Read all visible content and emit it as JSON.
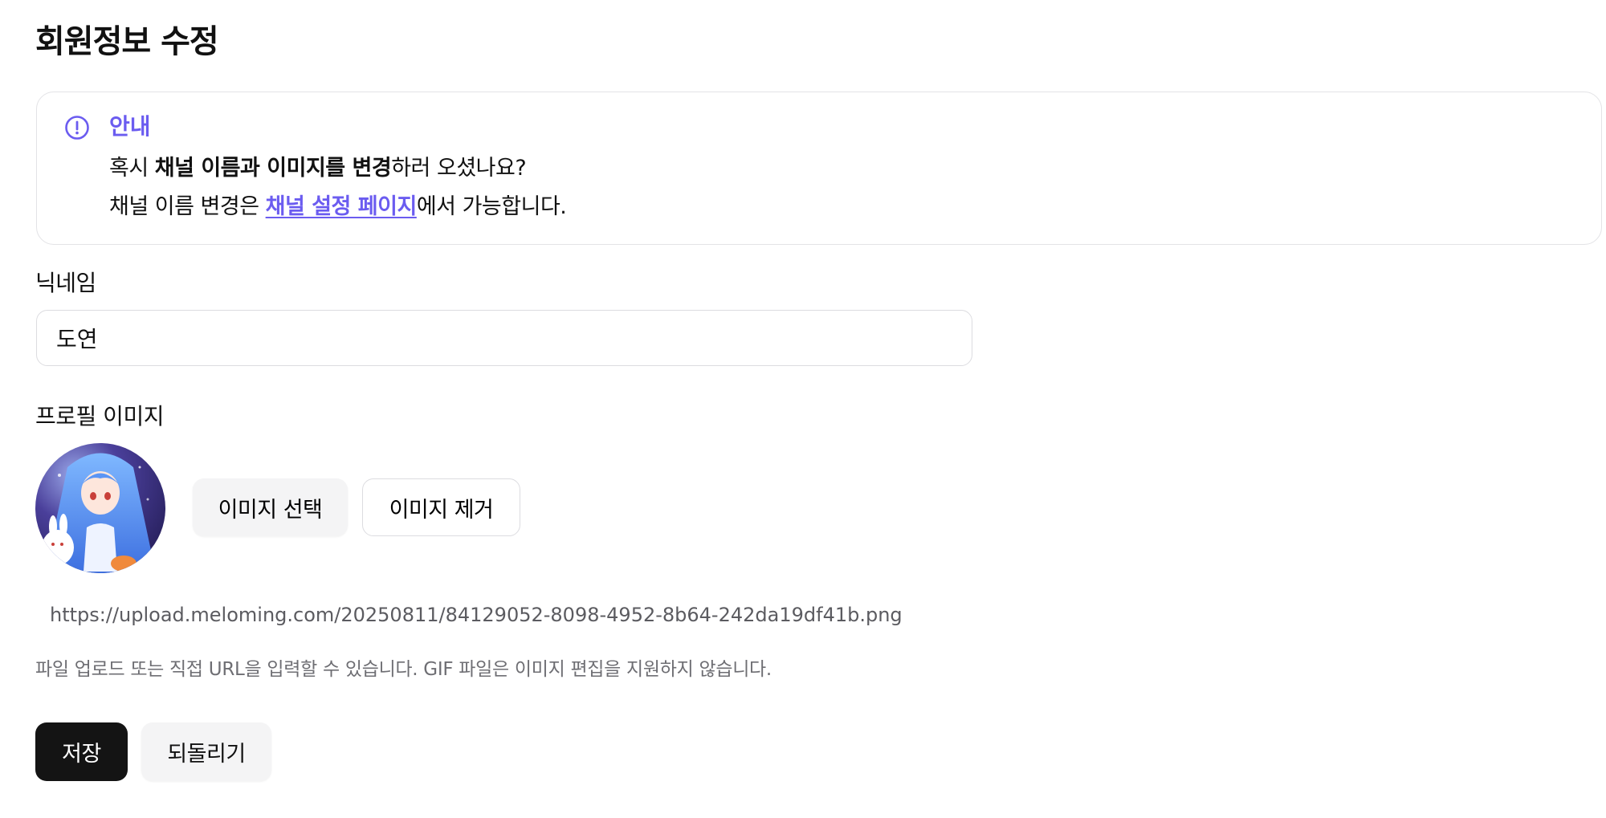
{
  "page": {
    "title": "회원정보 수정"
  },
  "notice": {
    "icon": "alert-circle-icon",
    "accent_color": "#6b5cf0",
    "title": "안내",
    "line1_prefix": "혹시 ",
    "line1_bold": "채널 이름과 이미지를 변경",
    "line1_suffix": "하러 오셨나요?",
    "line2_prefix": "채널 이름 변경은 ",
    "line2_link": "채널 설정 페이지",
    "line2_suffix": "에서 가능합니다."
  },
  "nickname": {
    "label": "닉네임",
    "value": "도연"
  },
  "profile_image": {
    "label": "프로필 이미지",
    "avatar_alt": "anime-girl-avatar",
    "select_button": "이미지 선택",
    "remove_button": "이미지 제거",
    "url_value": "https://upload.meloming.com/20250811/84129052-8098-4952-8b64-242da19df41b.png",
    "help_text": "파일 업로드 또는 직접 URL을 입력할 수 있습니다. GIF 파일은 이미지 편집을 지원하지 않습니다."
  },
  "actions": {
    "save": "저장",
    "revert": "되돌리기"
  }
}
